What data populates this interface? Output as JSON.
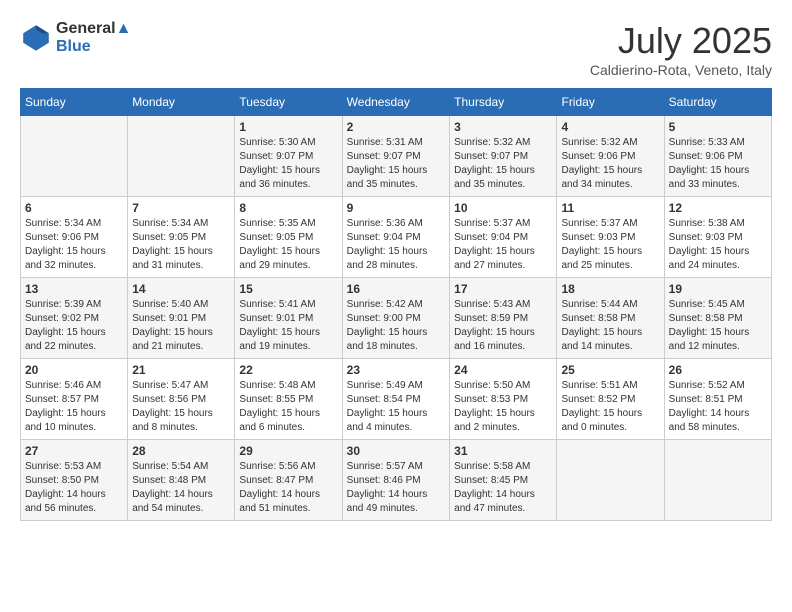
{
  "header": {
    "logo_line1": "General",
    "logo_line2": "Blue",
    "title": "July 2025",
    "location": "Caldierino-Rota, Veneto, Italy"
  },
  "days_of_week": [
    "Sunday",
    "Monday",
    "Tuesday",
    "Wednesday",
    "Thursday",
    "Friday",
    "Saturday"
  ],
  "weeks": [
    [
      {
        "day": "",
        "content": ""
      },
      {
        "day": "",
        "content": ""
      },
      {
        "day": "1",
        "content": "Sunrise: 5:30 AM\nSunset: 9:07 PM\nDaylight: 15 hours and 36 minutes."
      },
      {
        "day": "2",
        "content": "Sunrise: 5:31 AM\nSunset: 9:07 PM\nDaylight: 15 hours and 35 minutes."
      },
      {
        "day": "3",
        "content": "Sunrise: 5:32 AM\nSunset: 9:07 PM\nDaylight: 15 hours and 35 minutes."
      },
      {
        "day": "4",
        "content": "Sunrise: 5:32 AM\nSunset: 9:06 PM\nDaylight: 15 hours and 34 minutes."
      },
      {
        "day": "5",
        "content": "Sunrise: 5:33 AM\nSunset: 9:06 PM\nDaylight: 15 hours and 33 minutes."
      }
    ],
    [
      {
        "day": "6",
        "content": "Sunrise: 5:34 AM\nSunset: 9:06 PM\nDaylight: 15 hours and 32 minutes."
      },
      {
        "day": "7",
        "content": "Sunrise: 5:34 AM\nSunset: 9:05 PM\nDaylight: 15 hours and 31 minutes."
      },
      {
        "day": "8",
        "content": "Sunrise: 5:35 AM\nSunset: 9:05 PM\nDaylight: 15 hours and 29 minutes."
      },
      {
        "day": "9",
        "content": "Sunrise: 5:36 AM\nSunset: 9:04 PM\nDaylight: 15 hours and 28 minutes."
      },
      {
        "day": "10",
        "content": "Sunrise: 5:37 AM\nSunset: 9:04 PM\nDaylight: 15 hours and 27 minutes."
      },
      {
        "day": "11",
        "content": "Sunrise: 5:37 AM\nSunset: 9:03 PM\nDaylight: 15 hours and 25 minutes."
      },
      {
        "day": "12",
        "content": "Sunrise: 5:38 AM\nSunset: 9:03 PM\nDaylight: 15 hours and 24 minutes."
      }
    ],
    [
      {
        "day": "13",
        "content": "Sunrise: 5:39 AM\nSunset: 9:02 PM\nDaylight: 15 hours and 22 minutes."
      },
      {
        "day": "14",
        "content": "Sunrise: 5:40 AM\nSunset: 9:01 PM\nDaylight: 15 hours and 21 minutes."
      },
      {
        "day": "15",
        "content": "Sunrise: 5:41 AM\nSunset: 9:01 PM\nDaylight: 15 hours and 19 minutes."
      },
      {
        "day": "16",
        "content": "Sunrise: 5:42 AM\nSunset: 9:00 PM\nDaylight: 15 hours and 18 minutes."
      },
      {
        "day": "17",
        "content": "Sunrise: 5:43 AM\nSunset: 8:59 PM\nDaylight: 15 hours and 16 minutes."
      },
      {
        "day": "18",
        "content": "Sunrise: 5:44 AM\nSunset: 8:58 PM\nDaylight: 15 hours and 14 minutes."
      },
      {
        "day": "19",
        "content": "Sunrise: 5:45 AM\nSunset: 8:58 PM\nDaylight: 15 hours and 12 minutes."
      }
    ],
    [
      {
        "day": "20",
        "content": "Sunrise: 5:46 AM\nSunset: 8:57 PM\nDaylight: 15 hours and 10 minutes."
      },
      {
        "day": "21",
        "content": "Sunrise: 5:47 AM\nSunset: 8:56 PM\nDaylight: 15 hours and 8 minutes."
      },
      {
        "day": "22",
        "content": "Sunrise: 5:48 AM\nSunset: 8:55 PM\nDaylight: 15 hours and 6 minutes."
      },
      {
        "day": "23",
        "content": "Sunrise: 5:49 AM\nSunset: 8:54 PM\nDaylight: 15 hours and 4 minutes."
      },
      {
        "day": "24",
        "content": "Sunrise: 5:50 AM\nSunset: 8:53 PM\nDaylight: 15 hours and 2 minutes."
      },
      {
        "day": "25",
        "content": "Sunrise: 5:51 AM\nSunset: 8:52 PM\nDaylight: 15 hours and 0 minutes."
      },
      {
        "day": "26",
        "content": "Sunrise: 5:52 AM\nSunset: 8:51 PM\nDaylight: 14 hours and 58 minutes."
      }
    ],
    [
      {
        "day": "27",
        "content": "Sunrise: 5:53 AM\nSunset: 8:50 PM\nDaylight: 14 hours and 56 minutes."
      },
      {
        "day": "28",
        "content": "Sunrise: 5:54 AM\nSunset: 8:48 PM\nDaylight: 14 hours and 54 minutes."
      },
      {
        "day": "29",
        "content": "Sunrise: 5:56 AM\nSunset: 8:47 PM\nDaylight: 14 hours and 51 minutes."
      },
      {
        "day": "30",
        "content": "Sunrise: 5:57 AM\nSunset: 8:46 PM\nDaylight: 14 hours and 49 minutes."
      },
      {
        "day": "31",
        "content": "Sunrise: 5:58 AM\nSunset: 8:45 PM\nDaylight: 14 hours and 47 minutes."
      },
      {
        "day": "",
        "content": ""
      },
      {
        "day": "",
        "content": ""
      }
    ]
  ]
}
